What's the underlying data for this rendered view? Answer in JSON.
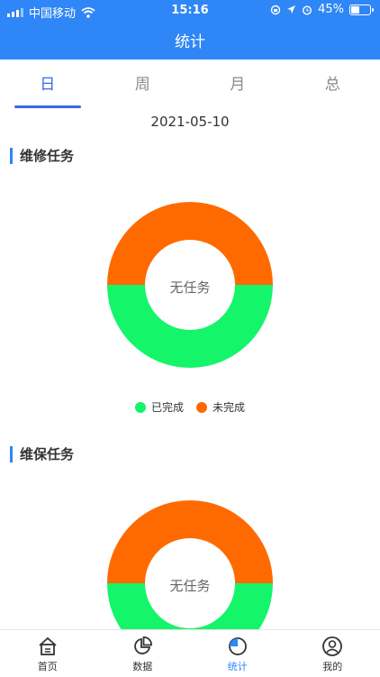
{
  "status_bar": {
    "carrier": "中国移动",
    "time": "15:16",
    "battery": "45%"
  },
  "header": {
    "title": "统计"
  },
  "tabs": [
    {
      "label": "日",
      "active": true
    },
    {
      "label": "周",
      "active": false
    },
    {
      "label": "月",
      "active": false
    },
    {
      "label": "总",
      "active": false
    }
  ],
  "date": "2021-05-10",
  "sections": [
    {
      "title": "维修任务",
      "center_text": "无任务"
    },
    {
      "title": "维保任务",
      "center_text": "无任务"
    }
  ],
  "legend": [
    {
      "label": "已完成",
      "color": "#14f56a"
    },
    {
      "label": "未完成",
      "color": "#ff6a00"
    }
  ],
  "bottom_nav": [
    {
      "label": "首页",
      "icon": "home-icon"
    },
    {
      "label": "数据",
      "icon": "pie-icon"
    },
    {
      "label": "统计",
      "icon": "stats-icon",
      "active": true
    },
    {
      "label": "我的",
      "icon": "user-icon"
    }
  ],
  "colors": {
    "primary": "#2f86f6",
    "completed": "#14f56a",
    "incomplete": "#ff6a00"
  }
}
